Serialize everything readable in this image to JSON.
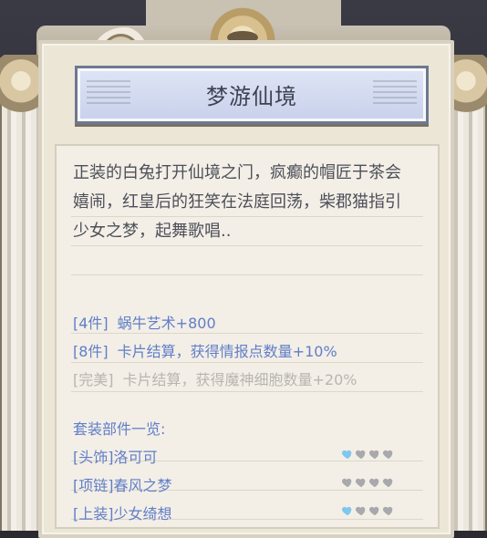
{
  "title": "梦游仙境",
  "description": "正装的白兔打开仙境之门，疯癫的帽匠于茶会\n嬉闹，红皇后的狂笑在法庭回荡，柴郡猫指引\n少女之梦，起舞歌唱..",
  "bonuses": [
    {
      "tag": "[4件]",
      "text": "蜗牛艺术+800"
    },
    {
      "tag": "[8件]",
      "text": "卡片结算，获得情报点数量+10%"
    },
    {
      "tag": "[完美]",
      "text": "卡片结算，获得魔神细胞数量+20%"
    }
  ],
  "set_title": "套装部件一览:",
  "items": [
    {
      "label": "[头饰]洛可可",
      "filled_hearts": 1,
      "total_hearts": 4
    },
    {
      "label": "[项链]春风之梦",
      "filled_hearts": 0,
      "total_hearts": 4
    },
    {
      "label": "[上装]少女绮想",
      "filled_hearts": 1,
      "total_hearts": 4
    }
  ],
  "colors": {
    "title_text": "#3f4253",
    "body_text": "#4d4f59",
    "blue_text": "#607ec8",
    "disabled_text": "#b8b5af",
    "heart_filled": "#7ec7ef",
    "heart_empty": "#a8a8ad"
  }
}
